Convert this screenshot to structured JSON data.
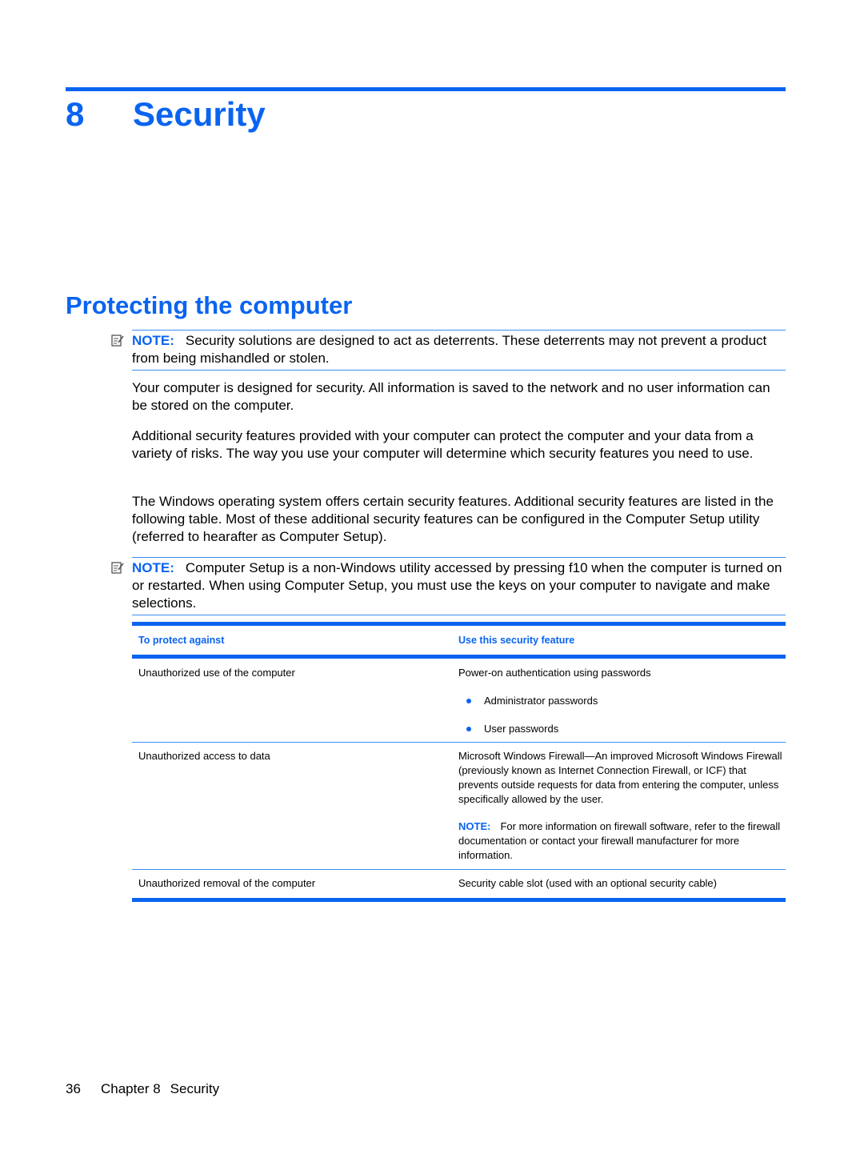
{
  "chapter": {
    "number": "8",
    "title": "Security"
  },
  "section": {
    "title": "Protecting the computer"
  },
  "notes": [
    {
      "label": "NOTE:",
      "text": "Security solutions are designed to act as deterrents. These deterrents may not prevent a product from being mishandled or stolen.",
      "icon": "note-icon"
    },
    {
      "label": "NOTE:",
      "text": "Computer Setup is a non-Windows utility accessed by pressing f10 when the computer is turned on or restarted. When using Computer Setup, you must use the keys on your computer to navigate and make selections.",
      "icon": "note-icon"
    }
  ],
  "paragraphs": [
    "Your computer is designed for security. All information is saved to the network and no user information can be stored on the computer.",
    "Additional security features provided with your computer can protect the computer and your data from a variety of risks. The way you use your computer will determine which security features you need to use.",
    "The Windows operating system offers certain security features. Additional security features are listed in the following table. Most of these additional security features can be configured in the Computer Setup utility (referred to hearafter as Computer Setup)."
  ],
  "table": {
    "headers": [
      "To protect against",
      "Use this security feature"
    ],
    "rows": [
      {
        "threat": "Unauthorized use of the computer",
        "feature": "Power-on authentication using passwords",
        "bullets": [
          "Administrator passwords",
          "User passwords"
        ]
      },
      {
        "threat": "Unauthorized access to data",
        "feature": "Microsoft Windows Firewall—An improved Microsoft Windows Firewall (previously known as Internet Connection Firewall, or ICF) that prevents outside requests for data from entering the computer, unless specifically allowed by the user.",
        "note_label": "NOTE:",
        "note_text": "For more information on firewall software, refer to the firewall documentation or contact your firewall manufacturer for more information."
      },
      {
        "threat": "Unauthorized removal of the computer",
        "feature": "Security cable slot (used with an optional security cable)"
      }
    ]
  },
  "footer": {
    "page_number": "36",
    "chapter_label": "Chapter 8",
    "chapter_title": "Security"
  },
  "colors": {
    "accent": "#0a64f0",
    "rule_thin": "#3c8cf0",
    "text": "#000000"
  }
}
